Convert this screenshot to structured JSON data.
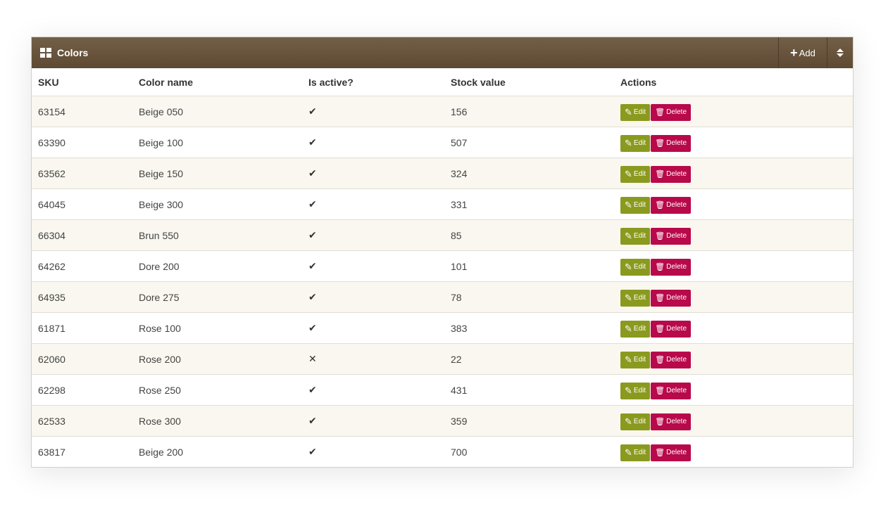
{
  "panel": {
    "title": "Colors",
    "add_label": "Add",
    "grid_icon": "grid-icon",
    "sort_icon": "sort-icon"
  },
  "table": {
    "headers": {
      "sku": "SKU",
      "name": "Color name",
      "active": "Is active?",
      "stock": "Stock value",
      "actions": "Actions"
    },
    "edit_label": "Edit",
    "delete_label": "Delete",
    "active_true_glyph": "✔",
    "active_false_glyph": "✕",
    "rows": [
      {
        "sku": "63154",
        "name": "Beige 050",
        "active": true,
        "stock": "156"
      },
      {
        "sku": "63390",
        "name": "Beige 100",
        "active": true,
        "stock": "507"
      },
      {
        "sku": "63562",
        "name": "Beige 150",
        "active": true,
        "stock": "324"
      },
      {
        "sku": "64045",
        "name": "Beige 300",
        "active": true,
        "stock": "331"
      },
      {
        "sku": "66304",
        "name": "Brun 550",
        "active": true,
        "stock": "85"
      },
      {
        "sku": "64262",
        "name": "Dore 200",
        "active": true,
        "stock": "101"
      },
      {
        "sku": "64935",
        "name": "Dore 275",
        "active": true,
        "stock": "78"
      },
      {
        "sku": "61871",
        "name": "Rose 100",
        "active": true,
        "stock": "383"
      },
      {
        "sku": "62060",
        "name": "Rose 200",
        "active": false,
        "stock": "22"
      },
      {
        "sku": "62298",
        "name": "Rose 250",
        "active": true,
        "stock": "431"
      },
      {
        "sku": "62533",
        "name": "Rose 300",
        "active": true,
        "stock": "359"
      },
      {
        "sku": "63817",
        "name": "Beige 200",
        "active": true,
        "stock": "700"
      }
    ]
  },
  "colors": {
    "header_bg": "#6b5740",
    "edit_bg": "#8a9a1e",
    "delete_bg": "#b8094a",
    "row_alt_bg": "#f9f7ef"
  }
}
